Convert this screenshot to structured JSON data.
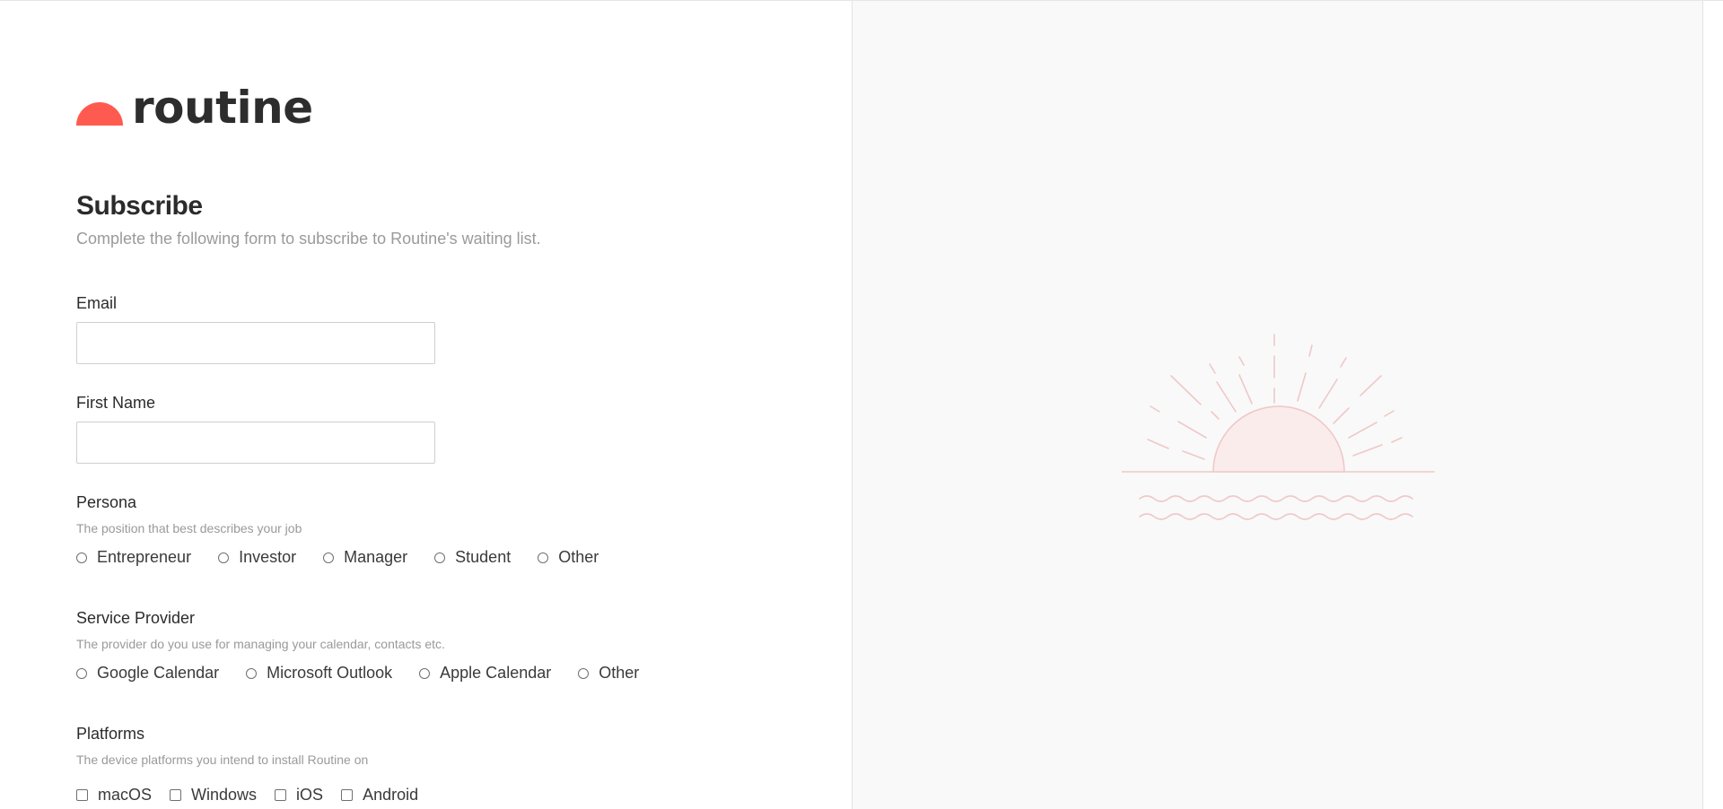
{
  "brand": {
    "name": "routine",
    "accent_color": "#ff5a4f"
  },
  "form": {
    "title": "Subscribe",
    "subtitle": "Complete the following form to subscribe to Routine's waiting list.",
    "email": {
      "label": "Email",
      "value": "",
      "placeholder": ""
    },
    "first_name": {
      "label": "First Name",
      "value": "",
      "placeholder": ""
    },
    "persona": {
      "label": "Persona",
      "help": "The position that best describes your job",
      "options": [
        "Entrepreneur",
        "Investor",
        "Manager",
        "Student",
        "Other"
      ]
    },
    "service_provider": {
      "label": "Service Provider",
      "help": "The provider do you use for managing your calendar, contacts etc.",
      "options": [
        "Google Calendar",
        "Microsoft Outlook",
        "Apple Calendar",
        "Other"
      ]
    },
    "platforms": {
      "label": "Platforms",
      "help": "The device platforms you intend to install Routine on",
      "options": [
        "macOS",
        "Windows",
        "iOS",
        "Android"
      ]
    }
  },
  "illustration": {
    "icon": "sunrise-illustration",
    "stroke_color": "#f0c8c8",
    "fill_color": "#fbecec"
  }
}
